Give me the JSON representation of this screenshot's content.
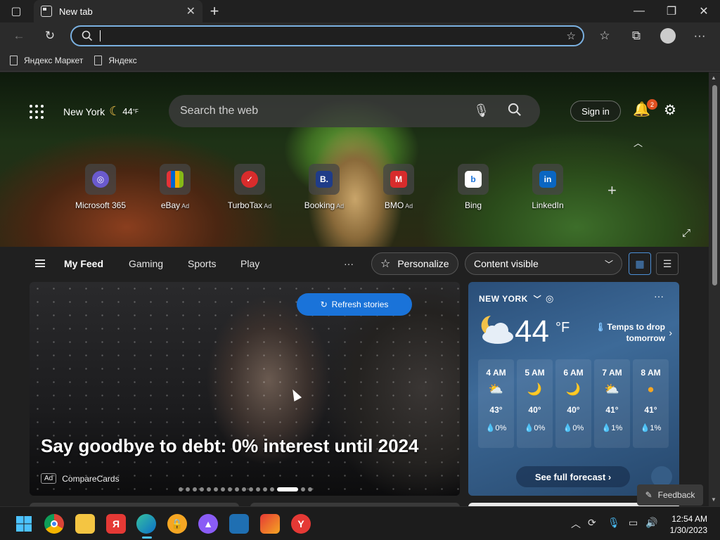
{
  "browser": {
    "tab_title": "New tab",
    "address_placeholder": "",
    "bookmarks": [
      "Яндекс Маркет",
      "Яндекс"
    ]
  },
  "newtab": {
    "location": "New York",
    "temp_mini": "44",
    "temp_mini_unit": "°F",
    "search_placeholder": "Search the web",
    "sign_in": "Sign in",
    "notifications": "2",
    "tiles": [
      {
        "label": "Microsoft 365",
        "ad": "",
        "color": "#6a5acd",
        "glyph": "◎"
      },
      {
        "label": "eBay",
        "ad": "Ad",
        "color": "#2b2b2b",
        "glyph": "🛍"
      },
      {
        "label": "TurboTax",
        "ad": "Ad",
        "color": "#d82c2c",
        "glyph": "✓"
      },
      {
        "label": "Booking",
        "ad": "Ad",
        "color": "#1f3c88",
        "glyph": "B."
      },
      {
        "label": "BMO",
        "ad": "Ad",
        "color": "#d82c2c",
        "glyph": "M"
      },
      {
        "label": "Bing",
        "ad": "",
        "color": "#ffffff",
        "glyph": "b"
      },
      {
        "label": "LinkedIn",
        "ad": "",
        "color": "#0a66c2",
        "glyph": "in"
      }
    ]
  },
  "feed": {
    "tabs": [
      "My Feed",
      "Gaming",
      "Sports",
      "Play"
    ],
    "more": "···",
    "personalize": "Personalize",
    "content_visible": "Content visible",
    "refresh": "Refresh stories",
    "headline": "Say goodbye to debt: 0% interest until 2024",
    "ad_badge": "Ad",
    "source": "CompareCards",
    "feedback": "Feedback"
  },
  "weather": {
    "city": "NEW YORK",
    "temp": "44",
    "unit": "°F",
    "alert": "Temps to drop tomorrow",
    "hours": [
      {
        "time": "4 AM",
        "icon": "⛅",
        "temp": "43°",
        "precip": "0%"
      },
      {
        "time": "5 AM",
        "icon": "🌙",
        "temp": "40°",
        "precip": "0%"
      },
      {
        "time": "6 AM",
        "icon": "🌙",
        "temp": "40°",
        "precip": "0%"
      },
      {
        "time": "7 AM",
        "icon": "⛅",
        "temp": "41°",
        "precip": "1%"
      },
      {
        "time": "8 AM",
        "icon": "●",
        "temp": "41°",
        "precip": "1%"
      }
    ],
    "forecast_btn": "See full forecast ›"
  },
  "taskbar": {
    "time": "12:54 AM",
    "date": "1/30/2023"
  }
}
